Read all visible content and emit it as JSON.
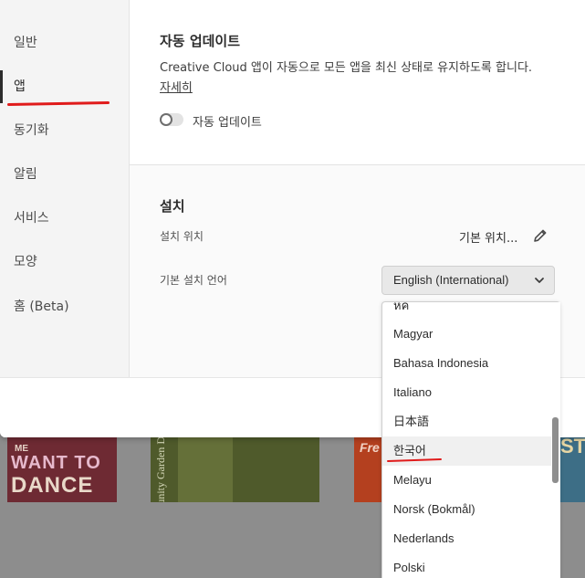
{
  "colors": {
    "accent_mark": "#e01b1b",
    "sidebar_bg": "#f4f4f4",
    "select_bg": "#e8e8e8"
  },
  "sidebar": {
    "items": [
      {
        "label": "일반"
      },
      {
        "label": "앱"
      },
      {
        "label": "동기화"
      },
      {
        "label": "알림"
      },
      {
        "label": "서비스"
      },
      {
        "label": "모양"
      },
      {
        "label": "홈 (Beta)"
      }
    ],
    "active_index": 1
  },
  "auto_update": {
    "title": "자동 업데이트",
    "description": "Creative Cloud 앱이 자동으로 모든 앱을 최신 상태로 유지하도록 합니다.",
    "learn_more": "자세히",
    "toggle_label": "자동 업데이트",
    "toggle_on": false
  },
  "install": {
    "title": "설치",
    "location_label": "설치 위치",
    "location_value": "기본 위치...",
    "language_label": "기본 설치 언어",
    "language_value": "English (International)",
    "options": [
      "Magyar",
      "Bahasa Indonesia",
      "Italiano",
      "日本語",
      "한국어",
      "Melayu",
      "Norsk (Bokmål)",
      "Nederlands",
      "Polski"
    ],
    "hovered_option": "한국어",
    "partial_option_above": "ห์ค"
  },
  "background": {
    "card1_line1": "ME",
    "card1_line2": "WANT TO",
    "card1_line3": "DANCE",
    "card2_text": "Community Garden D",
    "card3_text": "Fre R",
    "card4_text": "STI"
  }
}
